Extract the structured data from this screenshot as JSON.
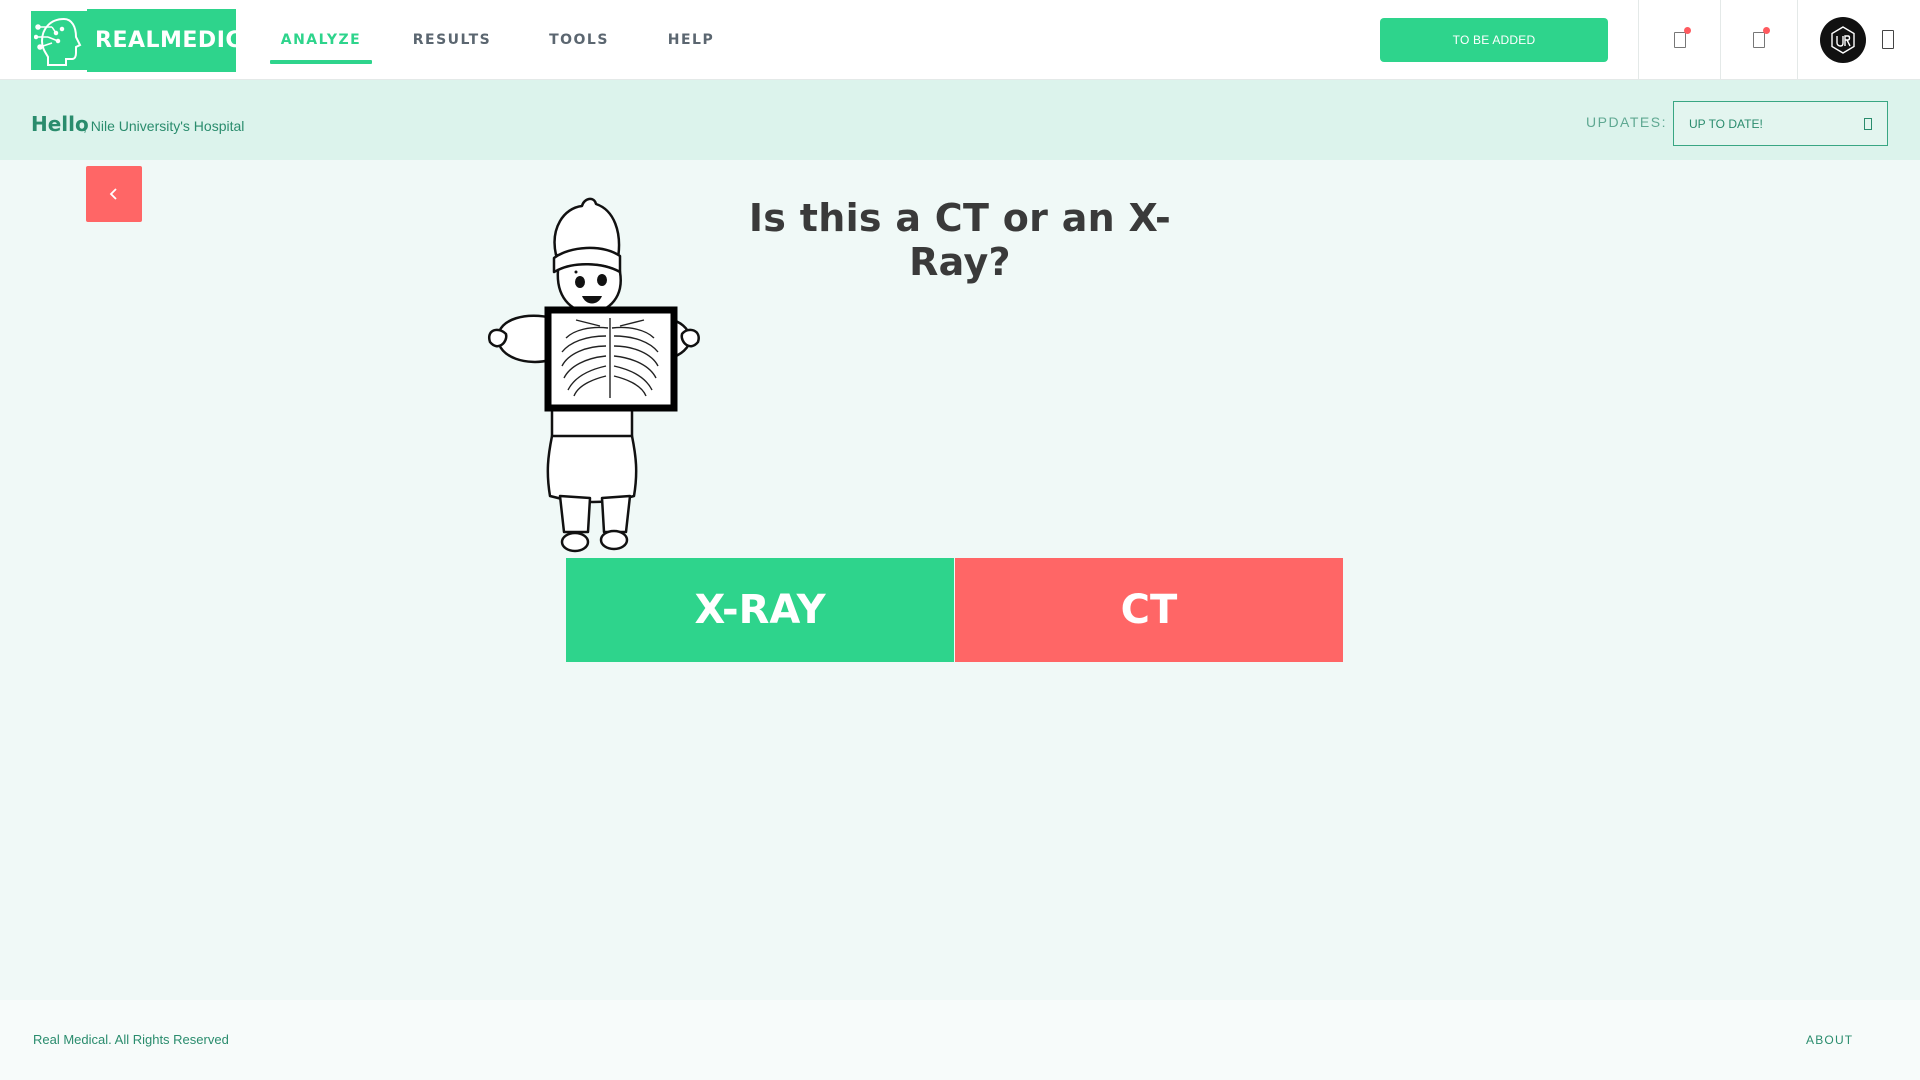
{
  "header": {
    "logo_text": "REALMEDICAL",
    "nav": [
      {
        "label": "ANALYZE",
        "active": true
      },
      {
        "label": "RESULTS",
        "active": false
      },
      {
        "label": "TOOLS",
        "active": false
      },
      {
        "label": "HELP",
        "active": false
      }
    ],
    "action_button": "TO BE ADDED",
    "icons": [
      "notification-icon",
      "notification-icon",
      "avatar-icon",
      "menu-icon"
    ]
  },
  "greeting": {
    "hello": "Hello",
    "hospital": ", Nile University's Hospital",
    "updates_label": "UPDATES:",
    "updates_value": "UP TO DATE!"
  },
  "main": {
    "question": "Is this a CT or an X-Ray?",
    "options": {
      "xray": "X-RAY",
      "ct": "CT"
    }
  },
  "footer": {
    "copyright": "Real Medical. All Rights Reserved",
    "about": "ABOUT"
  },
  "colors": {
    "brand_green": "#2ed48c",
    "accent_red": "#ff6666",
    "subbar_bg": "#dcf3ec",
    "page_bg": "#f0f9f7",
    "text_green": "#2a8c6d"
  }
}
